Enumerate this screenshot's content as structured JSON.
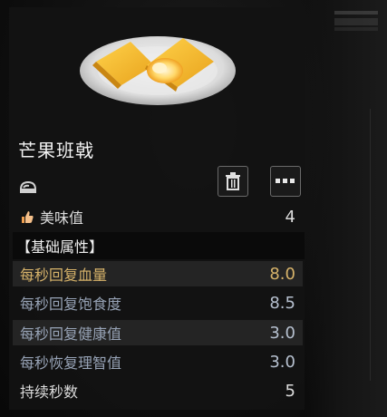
{
  "item": {
    "name": "芒果班戟",
    "icon": "plate-of-mango-pancakes"
  },
  "actions": {
    "delete_icon": "trash-icon",
    "more_icon": "more-dots-icon"
  },
  "taste": {
    "label": "美味值",
    "value": "4",
    "icon": "thumbs-up-icon"
  },
  "section": {
    "title": "【基础属性】"
  },
  "attributes": [
    {
      "label": "每秒回复血量",
      "value": "8.0"
    },
    {
      "label": "每秒回复饱食度",
      "value": "8.5"
    },
    {
      "label": "每秒回复健康值",
      "value": "3.0"
    },
    {
      "label": "每秒恢复理智值",
      "value": "3.0"
    }
  ],
  "duration": {
    "label": "持续秒数",
    "value": "5"
  },
  "colors": {
    "highlight": "#d7b36a",
    "attr_text": "#97a3b6",
    "white_text": "#f2f2f2"
  }
}
